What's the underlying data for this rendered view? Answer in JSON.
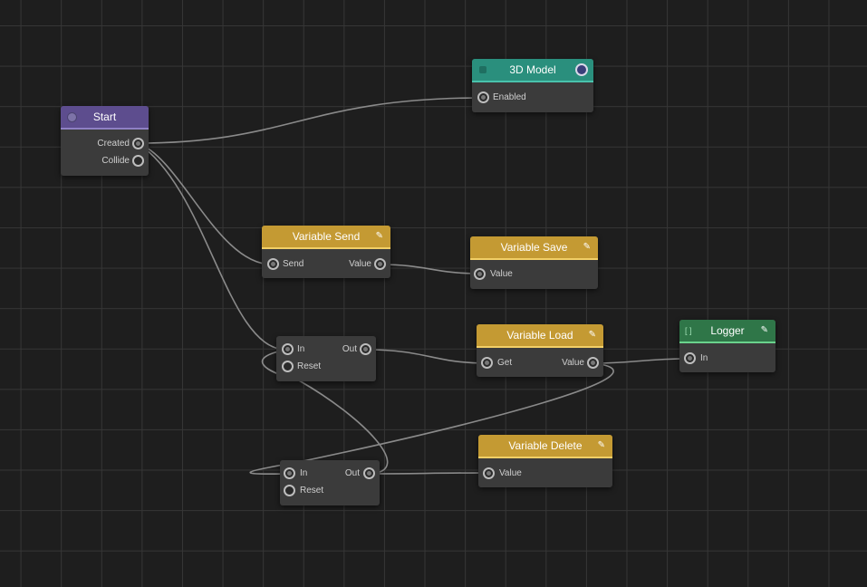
{
  "nodes": {
    "start": {
      "title": "Start",
      "outputs": [
        "Created",
        "Collide"
      ]
    },
    "model": {
      "title": "3D Model",
      "inputs": [
        "Enabled"
      ]
    },
    "var_send": {
      "title": "Variable Send",
      "inputs": [
        "Send"
      ],
      "outputs": [
        "Value"
      ]
    },
    "var_save": {
      "title": "Variable Save",
      "inputs": [
        "Value"
      ]
    },
    "gate1": {
      "inputs": [
        "In",
        "Reset"
      ],
      "outputs": [
        "Out"
      ]
    },
    "var_load": {
      "title": "Variable Load",
      "inputs": [
        "Get"
      ],
      "outputs": [
        "Value"
      ]
    },
    "logger": {
      "title": "Logger",
      "inputs": [
        "In"
      ]
    },
    "gate2": {
      "inputs": [
        "In",
        "Reset"
      ],
      "outputs": [
        "Out"
      ]
    },
    "var_delete": {
      "title": "Variable Delete",
      "inputs": [
        "Value"
      ]
    }
  },
  "icons": {
    "edit": "✎",
    "start": "start-node-icon",
    "model": "cube-icon",
    "logger": "bracket-icon"
  },
  "colors": {
    "start_header": "#5d4d8e",
    "model_header": "#2a8f7d",
    "variable_header": "#c49a33",
    "logger_header": "#2f7648",
    "wire": "#8a8a8a",
    "canvas": "#1e1e1e"
  }
}
